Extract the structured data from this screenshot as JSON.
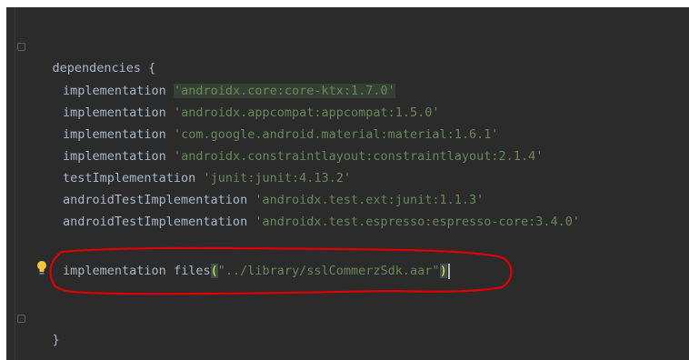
{
  "editor": {
    "block_open": "dependencies {",
    "block_close": "}",
    "lines": [
      {
        "keyword": "implementation",
        "value": "'androidx.core:core-ktx:1.7.0'",
        "highlighted": true
      },
      {
        "keyword": "implementation",
        "value": "'androidx.appcompat:appcompat:1.5.0'"
      },
      {
        "keyword": "implementation",
        "value": "'com.google.android.material:material:1.6.1'"
      },
      {
        "keyword": "implementation",
        "value": "'androidx.constraintlayout:constraintlayout:2.1.4'"
      },
      {
        "keyword": "testImplementation",
        "value": "'junit:junit:4.13.2'"
      },
      {
        "keyword": "androidTestImplementation",
        "value": "'androidx.test.ext:junit:1.1.3'"
      },
      {
        "keyword": "androidTestImplementation",
        "value": "'androidx.test.espresso:espresso-core:3.4.0'"
      }
    ],
    "annotated_line": {
      "keyword": "implementation",
      "call": "files",
      "open_paren": "(",
      "value": "\"../library/sslCommerzSdk.aar\"",
      "close_paren": ")"
    }
  },
  "colors": {
    "background": "#2b2b2b",
    "text": "#a9b7c6",
    "string": "#6a8759",
    "annotation": "#e00000",
    "bulb": "#f5c242"
  },
  "icons": [
    "fold-open-icon",
    "fold-close-icon",
    "lightbulb-icon"
  ]
}
